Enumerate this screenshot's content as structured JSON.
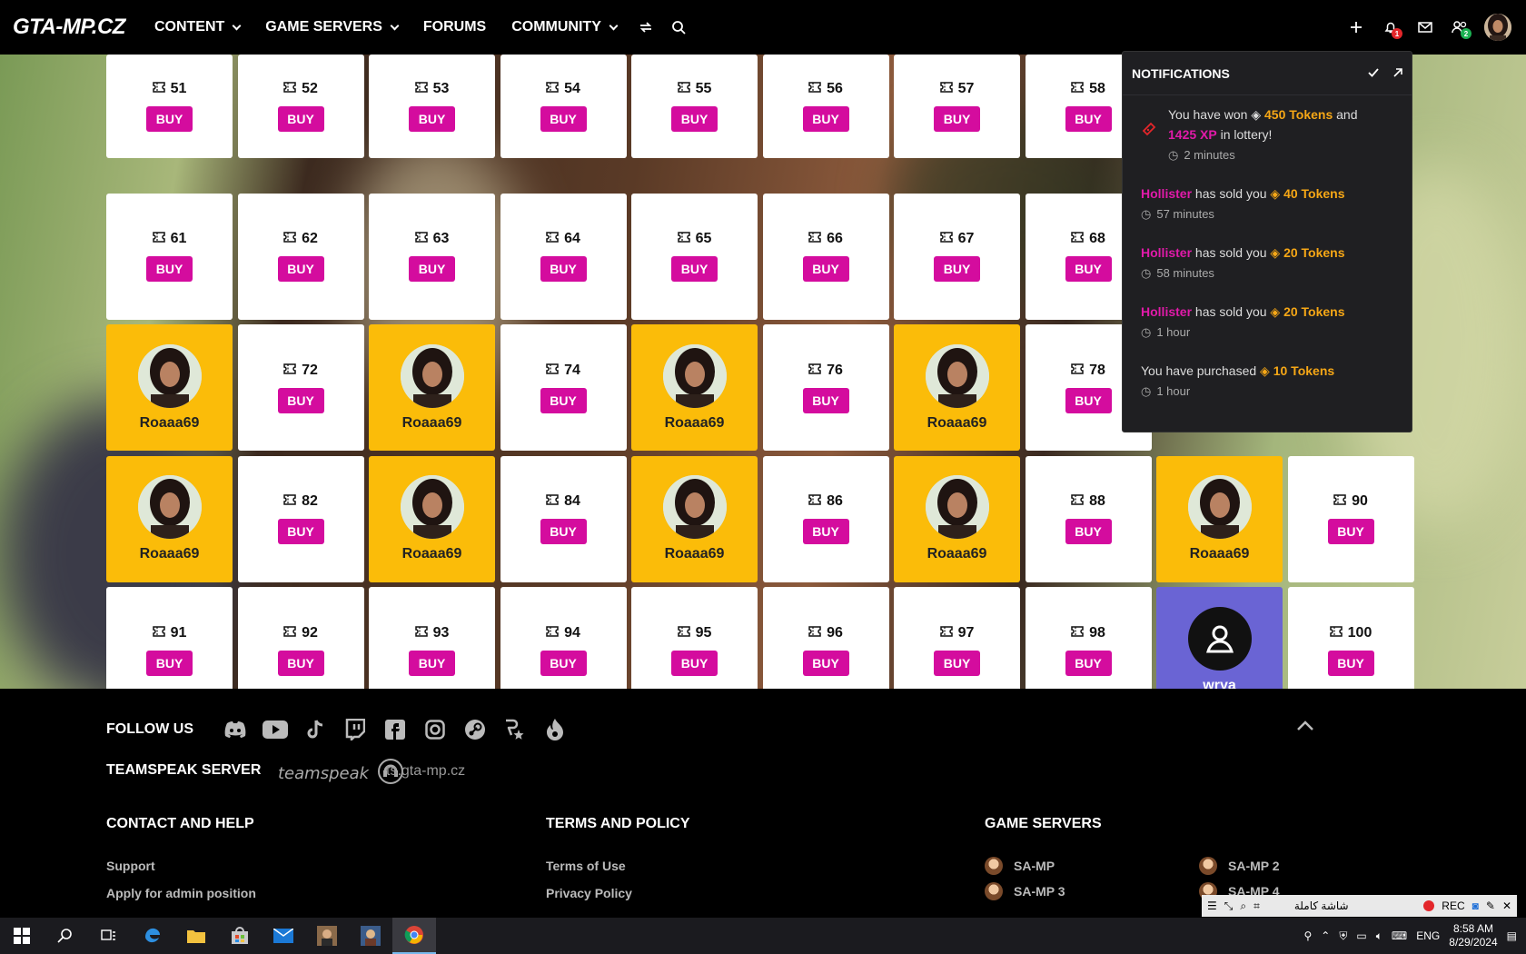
{
  "nav": {
    "logo": "GTA-MP.CZ",
    "items": [
      {
        "label": "CONTENT",
        "dropdown": true
      },
      {
        "label": "GAME SERVERS",
        "dropdown": true
      },
      {
        "label": "FORUMS",
        "dropdown": false
      },
      {
        "label": "COMMUNITY",
        "dropdown": true
      }
    ],
    "notification_badge": "1",
    "friends_badge": "2"
  },
  "grid": {
    "buy_label": "BUY",
    "rows": [
      [
        {
          "n": "51"
        },
        {
          "n": "52"
        },
        {
          "n": "53"
        },
        {
          "n": "54"
        },
        {
          "n": "55"
        },
        {
          "n": "56"
        },
        {
          "n": "57"
        },
        {
          "n": "58"
        }
      ],
      [
        {
          "n": "61"
        },
        {
          "n": "62"
        },
        {
          "n": "63"
        },
        {
          "n": "64"
        },
        {
          "n": "65"
        },
        {
          "n": "66"
        },
        {
          "n": "67"
        },
        {
          "n": "68"
        }
      ],
      [
        {
          "owner": "Roaaa69"
        },
        {
          "n": "72"
        },
        {
          "owner": "Roaaa69"
        },
        {
          "n": "74"
        },
        {
          "owner": "Roaaa69"
        },
        {
          "n": "76"
        },
        {
          "owner": "Roaaa69"
        },
        {
          "n": "78"
        }
      ],
      [
        {
          "owner": "Roaaa69"
        },
        {
          "n": "82"
        },
        {
          "owner": "Roaaa69"
        },
        {
          "n": "84"
        },
        {
          "owner": "Roaaa69"
        },
        {
          "n": "86"
        },
        {
          "owner": "Roaaa69"
        },
        {
          "n": "88"
        },
        {
          "owner": "Roaaa69"
        },
        {
          "n": "90"
        }
      ],
      [
        {
          "n": "91"
        },
        {
          "n": "92"
        },
        {
          "n": "93"
        },
        {
          "n": "94"
        },
        {
          "n": "95"
        },
        {
          "n": "96"
        },
        {
          "n": "97"
        },
        {
          "n": "98"
        },
        {
          "self": "wrya"
        },
        {
          "n": "100"
        }
      ]
    ]
  },
  "notifications": {
    "title": "NOTIFICATIONS",
    "items": [
      {
        "pre": "You have won",
        "tokens": "450 Tokens",
        "mid": "and",
        "xp": "1425 XP",
        "post": "in lottery!",
        "time": "2 minutes"
      },
      {
        "user": "Hollister",
        "text": "has sold you",
        "tokens": "40 Tokens",
        "time": "57 minutes"
      },
      {
        "user": "Hollister",
        "text": "has sold you",
        "tokens": "20 Tokens",
        "time": "58 minutes"
      },
      {
        "user": "Hollister",
        "text": "has sold you",
        "tokens": "20 Tokens",
        "time": "1 hour"
      },
      {
        "pre": "You have purchased",
        "tokens": "10 Tokens",
        "time": "1 hour"
      }
    ]
  },
  "footer": {
    "follow_us": "FOLLOW US",
    "teamspeak_heading": "TEAMSPEAK SERVER",
    "teamspeak_brand": "teamspeak",
    "teamspeak_address": "ts.gta-mp.cz",
    "contact_heading": "CONTACT AND HELP",
    "contact_links": [
      "Support",
      "Apply for admin position"
    ],
    "terms_heading": "TERMS AND POLICY",
    "terms_links": [
      "Terms of Use",
      "Privacy Policy"
    ],
    "servers_heading": "GAME SERVERS",
    "servers": [
      "SA-MP",
      "SA-MP 2",
      "SA-MP 3",
      "SA-MP 4"
    ]
  },
  "recorder": {
    "fullscreen_label": "شاشة كاملة",
    "rec_label": "REC"
  },
  "taskbar": {
    "lang": "ENG",
    "time": "8:58 AM",
    "date": "8/29/2024"
  },
  "colors": {
    "buy": "#d40c9e",
    "owned": "#fbbc09",
    "self": "#6a64d4",
    "token": "#f6a716",
    "user": "#e11aa9"
  }
}
